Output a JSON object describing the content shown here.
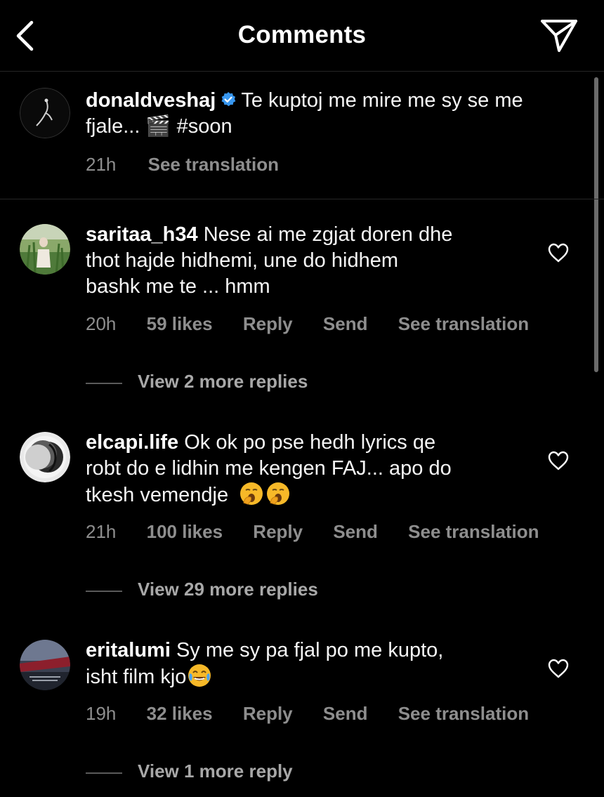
{
  "header": {
    "title": "Comments"
  },
  "caption": {
    "username": "donaldveshaj",
    "text_line1": "Te kuptoj me mire me sy se me",
    "text_line2": "fjale... 🎬 #soon",
    "time": "21h",
    "see_translation": "See translation"
  },
  "comments": [
    {
      "username": "saritaa_h34",
      "line1": "Nese ai me zgjat doren dhe",
      "line2": "thot hajde hidhemi, une do hidhem",
      "line3": "bashk me te ... hmm",
      "time": "20h",
      "likes": "59 likes",
      "reply": "Reply",
      "send": "Send",
      "see_translation": "See translation",
      "view_replies": "View 2 more replies"
    },
    {
      "username": "elcapi.life",
      "line1": "Ok ok po pse hedh lyrics qe",
      "line2": "robt do e lidhin me kengen FAJ... apo do",
      "line3": "tkesh vemendje",
      "time": "21h",
      "likes": "100 likes",
      "reply": "Reply",
      "send": "Send",
      "see_translation": "See translation",
      "view_replies": "View 29 more replies"
    },
    {
      "username": "eritalumi",
      "line1": "Sy me sy pa fjal po me kupto,",
      "line2": "isht film kjo",
      "time": "19h",
      "likes": "32 likes",
      "reply": "Reply",
      "send": "Send",
      "see_translation": "See translation",
      "view_replies": "View 1 more reply"
    }
  ],
  "icons": {
    "back": "chevron-left-icon",
    "share": "paper-plane-icon",
    "verified": "verified-badge-icon",
    "like": "heart-outline-icon"
  },
  "colors": {
    "background": "#000000",
    "text": "#f5f5f5",
    "secondary": "#8e8e8e",
    "verified": "#3897f0"
  }
}
